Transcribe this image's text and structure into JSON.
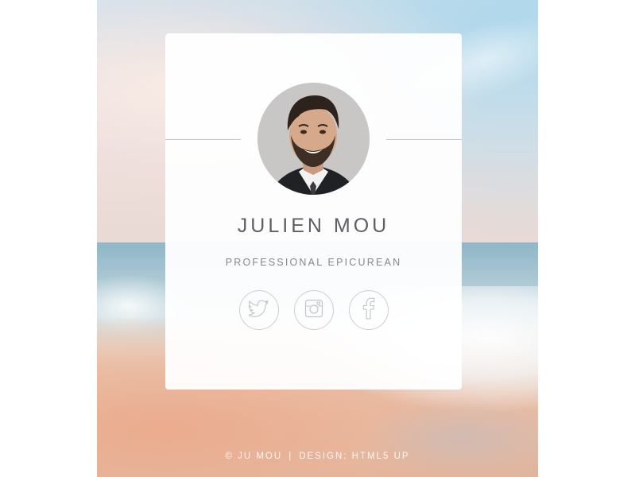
{
  "profile": {
    "name": "JULIEN MOU",
    "tagline": "PROFESSIONAL EPICUREAN"
  },
  "social": [
    {
      "icon": "twitter-icon"
    },
    {
      "icon": "instagram-icon"
    },
    {
      "icon": "facebook-icon"
    }
  ],
  "footer": {
    "copyright": "© JU MOU",
    "separator": "|",
    "design_credit": "DESIGN: HTML5 UP"
  },
  "colors": {
    "card_bg": "#ffffff",
    "text": "#5f5f66",
    "muted": "#86868e",
    "icon_stroke": "#c3c3c8"
  }
}
